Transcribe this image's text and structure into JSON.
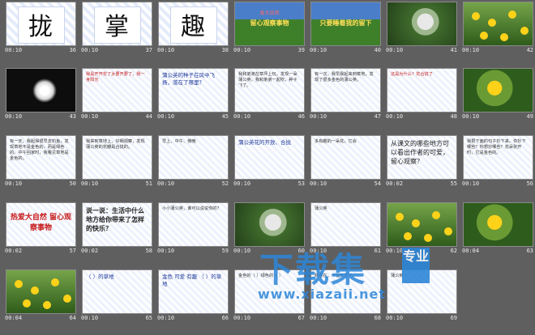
{
  "watermark": {
    "main": "下载集",
    "badge": "专业",
    "url": "www.xiazaii.net"
  },
  "rows": [
    [
      {
        "dur": "00:10",
        "num": "36",
        "kind": "char",
        "text": "拢"
      },
      {
        "dur": "00:10",
        "num": "37",
        "kind": "char",
        "text": "掌"
      },
      {
        "dur": "00:10",
        "num": "38",
        "kind": "char",
        "text": "趣"
      },
      {
        "dur": "00:10",
        "num": "39",
        "kind": "photo-title",
        "sub": "爱大自然",
        "text": "留心观察事物"
      },
      {
        "dur": "00:10",
        "num": "40",
        "kind": "photo-title",
        "sub": "",
        "text": "只要睡着我的留下"
      },
      {
        "dur": "00:10",
        "num": "41",
        "kind": "green"
      },
      {
        "dur": "00:10",
        "num": "42",
        "kind": "field"
      }
    ],
    [
      {
        "dur": "00:10",
        "num": "43",
        "kind": "dark"
      },
      {
        "dur": "00:10",
        "num": "44",
        "kind": "text",
        "style": "red",
        "text": "我是开开花了太要开要了，我一身阳光"
      },
      {
        "dur": "00:10",
        "num": "45",
        "kind": "text",
        "style": "mid",
        "text": "蒲公英的种子在风中飞扬，落在了哪里？"
      },
      {
        "dur": "00:10",
        "num": "46",
        "kind": "text",
        "style": "",
        "text": "我和弟弟在草坪上玩，发现一朵蒲公英，我和弟弟一起吹，种子飞了。"
      },
      {
        "dur": "00:10",
        "num": "47",
        "kind": "text",
        "style": "",
        "text": "有一次，我早晨起来到菜地，发现了很多金色的蒲公英。"
      },
      {
        "dur": "00:10",
        "num": "48",
        "kind": "text",
        "style": "red",
        "text": "这是为什么？花合拢了"
      },
      {
        "dur": "00:10",
        "num": "49",
        "kind": "yellow"
      }
    ],
    [
      {
        "dur": "00:10",
        "num": "50",
        "kind": "text",
        "style": "",
        "text": "有一天，我起得很早去钓鱼，发现草地不是金色的，而是绿色的。中午回家时，我看见草地是金色的。"
      },
      {
        "dur": "00:10",
        "num": "51",
        "kind": "text",
        "style": "",
        "text": "我来到草地上，仔细观察，发现蒲公英的花瓣是合拢的。"
      },
      {
        "dur": "00:10",
        "num": "52",
        "kind": "text",
        "style": "",
        "text": "早上、中午、傍晚"
      },
      {
        "dur": "00:10",
        "num": "53",
        "kind": "text",
        "style": "mid",
        "text": "蒲公英花的开放、合拢"
      },
      {
        "dur": "00:10",
        "num": "54",
        "kind": "text",
        "style": "",
        "text": "多有趣的一朵花，它会"
      },
      {
        "dur": "00:02",
        "num": "55",
        "kind": "text",
        "style": "big",
        "text": "从课文的哪些地方可以看出作者的可爱，留心观察？"
      },
      {
        "dur": "00:10",
        "num": "56",
        "kind": "text",
        "style": "",
        "text": "我把下面的句子抄下来。你抄下哪些？你想抄哪些？花朵张开时，它是金色的。"
      }
    ],
    [
      {
        "dur": "00:02",
        "num": "57",
        "kind": "text",
        "style": "bold",
        "text": "热爱大自然 留心观察事物"
      },
      {
        "dur": "00:02",
        "num": "58",
        "kind": "text",
        "style": "bold2",
        "text": "说一说：生活中什么地方给你带来了怎样的快乐？"
      },
      {
        "dur": "00:10",
        "num": "59",
        "kind": "text",
        "style": "",
        "text": "小小蒲公英，谁可以说说你的？"
      },
      {
        "dur": "00:10",
        "num": "60",
        "kind": "green"
      },
      {
        "dur": "00:10",
        "num": "61",
        "kind": "text",
        "style": "",
        "text": "蒲公英"
      },
      {
        "dur": "00:10",
        "num": "62",
        "kind": "field"
      },
      {
        "dur": "00:04",
        "num": "63",
        "kind": "yellow"
      }
    ],
    [
      {
        "dur": "00:04",
        "num": "64",
        "kind": "field"
      },
      {
        "dur": "00:10",
        "num": "65",
        "kind": "text",
        "style": "mid",
        "text": "（ ）的草地"
      },
      {
        "dur": "00:10",
        "num": "66",
        "kind": "text",
        "style": "mid",
        "text": "金色 可爱 有趣 （ ）的草地"
      },
      {
        "dur": "00:10",
        "num": "67",
        "kind": "text",
        "style": "",
        "text": "金色的（ ）绿色的（ ）"
      },
      {
        "dur": "00:10",
        "num": "68",
        "kind": "text",
        "style": "",
        "text": "我现在，一位天早了。"
      },
      {
        "dur": "00:10",
        "num": "69",
        "kind": "text",
        "style": "",
        "text": "蒲公英"
      }
    ]
  ]
}
